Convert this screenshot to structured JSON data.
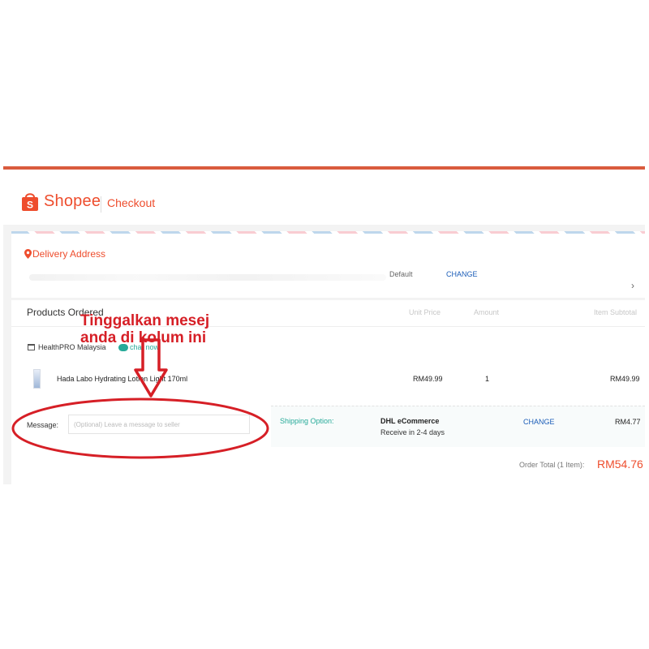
{
  "header": {
    "brand": "Shopee",
    "page_title": "Checkout"
  },
  "address": {
    "title": "Delivery Address",
    "default_label": "Default",
    "change_label": "CHANGE"
  },
  "products": {
    "title": "Products Ordered",
    "col_unit_price": "Unit Price",
    "col_amount": "Amount",
    "col_subtotal": "Item Subtotal",
    "shop_name": "HealthPRO Malaysia",
    "chat_label": "chat now",
    "item_name": "Hada Labo Hydrating Lotion Light 170ml",
    "item_price": "RM49.99",
    "item_qty": "1",
    "item_subtotal": "RM49.99"
  },
  "message": {
    "label": "Message:",
    "placeholder": "(Optional) Leave a message to seller",
    "value": ""
  },
  "shipping": {
    "label": "Shipping Option:",
    "carrier": "DHL eCommerce",
    "eta": "Receive in 2-4 days",
    "change_label": "CHANGE",
    "fee": "RM4.77"
  },
  "order_total": {
    "label": "Order Total (1 Item):",
    "value": "RM54.76"
  },
  "annotation": {
    "line1": "Tinggalkan mesej",
    "line2": "anda di kolum ini"
  },
  "colors": {
    "brand": "#ee4d2d",
    "annotation": "#d61f26",
    "link": "#1b5db8",
    "teal": "#26aa99"
  },
  "icons": [
    "shopee-bag-icon",
    "location-pin-icon",
    "chevron-right-icon",
    "shop-icon",
    "chat-icon",
    "product-thumbnail",
    "down-arrow-icon",
    "highlight-ellipse"
  ]
}
